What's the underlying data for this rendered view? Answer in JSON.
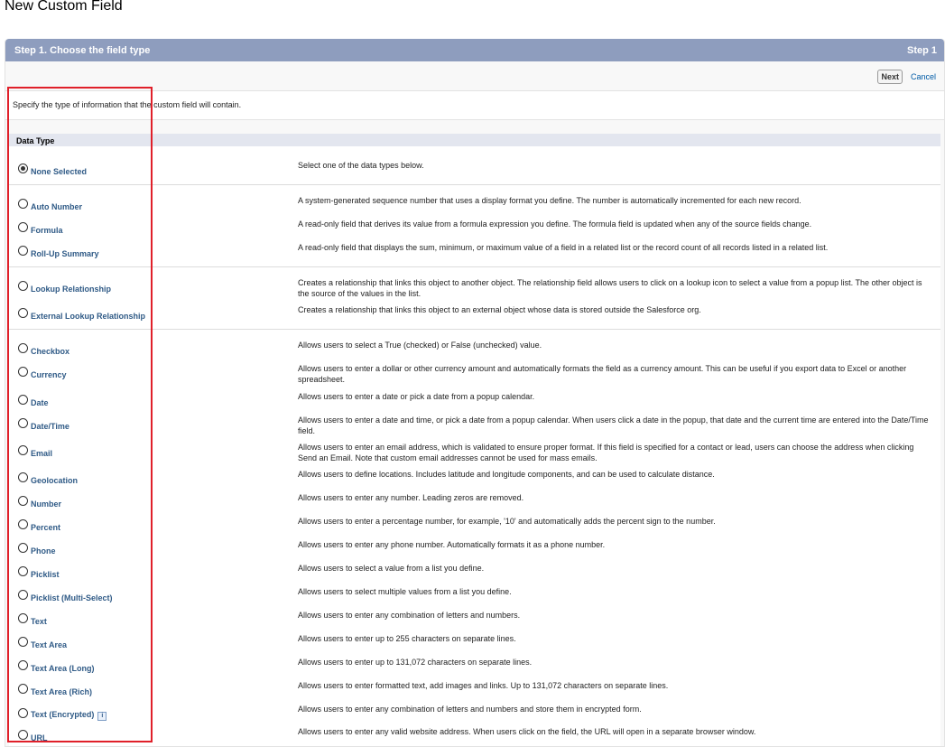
{
  "page": {
    "title": "New Custom Field"
  },
  "step": {
    "title": "Step 1. Choose the field type",
    "indicator": "Step 1"
  },
  "buttons": {
    "next": "Next",
    "cancel": "Cancel"
  },
  "instructions": "Specify the type of information that the custom field will contain.",
  "section": {
    "title": "Data Type"
  },
  "types": [
    {
      "label": "None Selected",
      "desc": "Select one of the data types below.",
      "checked": true
    },
    {
      "label": "Auto Number",
      "desc": "A system-generated sequence number that uses a display format you define. The number is automatically incremented for each new record."
    },
    {
      "label": "Formula",
      "desc": "A read-only field that derives its value from a formula expression you define. The formula field is updated when any of the source fields change."
    },
    {
      "label": "Roll-Up Summary",
      "desc": "A read-only field that displays the sum, minimum, or maximum value of a field in a related list or the record count of all records listed in a related list."
    },
    {
      "label": "Lookup Relationship",
      "desc": "Creates a relationship that links this object to another object. The relationship field allows users to click on a lookup icon to select a value from a popup list. The other object is the source of the values in the list."
    },
    {
      "label": "External Lookup Relationship",
      "desc": "Creates a relationship that links this object to an external object whose data is stored outside the Salesforce org."
    },
    {
      "label": "Checkbox",
      "desc": "Allows users to select a True (checked) or False (unchecked) value."
    },
    {
      "label": "Currency",
      "desc": "Allows users to enter a dollar or other currency amount and automatically formats the field as a currency amount. This can be useful if you export data to Excel or another spreadsheet."
    },
    {
      "label": "Date",
      "desc": "Allows users to enter a date or pick a date from a popup calendar."
    },
    {
      "label": "Date/Time",
      "desc": "Allows users to enter a date and time, or pick a date from a popup calendar. When users click a date in the popup, that date and the current time are entered into the Date/Time field."
    },
    {
      "label": "Email",
      "desc": "Allows users to enter an email address, which is validated to ensure proper format. If this field is specified for a contact or lead, users can choose the address when clicking Send an Email. Note that custom email addresses cannot be used for mass emails."
    },
    {
      "label": "Geolocation",
      "desc": "Allows users to define locations. Includes latitude and longitude components, and can be used to calculate distance."
    },
    {
      "label": "Number",
      "desc": "Allows users to enter any number. Leading zeros are removed."
    },
    {
      "label": "Percent",
      "desc": "Allows users to enter a percentage number, for example, '10' and automatically adds the percent sign to the number."
    },
    {
      "label": "Phone",
      "desc": "Allows users to enter any phone number. Automatically formats it as a phone number."
    },
    {
      "label": "Picklist",
      "desc": "Allows users to select a value from a list you define."
    },
    {
      "label": "Picklist (Multi-Select)",
      "desc": "Allows users to select multiple values from a list you define."
    },
    {
      "label": "Text",
      "desc": "Allows users to enter any combination of letters and numbers."
    },
    {
      "label": "Text Area",
      "desc": "Allows users to enter up to 255 characters on separate lines."
    },
    {
      "label": "Text Area (Long)",
      "desc": "Allows users to enter up to 131,072 characters on separate lines."
    },
    {
      "label": "Text Area (Rich)",
      "desc": "Allows users to enter formatted text, add images and links. Up to 131,072 characters on separate lines."
    },
    {
      "label": "Text (Encrypted)",
      "desc": "Allows users to enter any combination of letters and numbers and store them in encrypted form.",
      "info_icon": "i"
    },
    {
      "label": "URL",
      "desc": "Allows users to enter any valid website address. When users click on the field, the URL will open in a separate browser window."
    }
  ],
  "colors": {
    "header_bg": "#8e9dbe",
    "link": "#015ba7",
    "label": "#2f5a86",
    "highlight": "#e0202a"
  }
}
